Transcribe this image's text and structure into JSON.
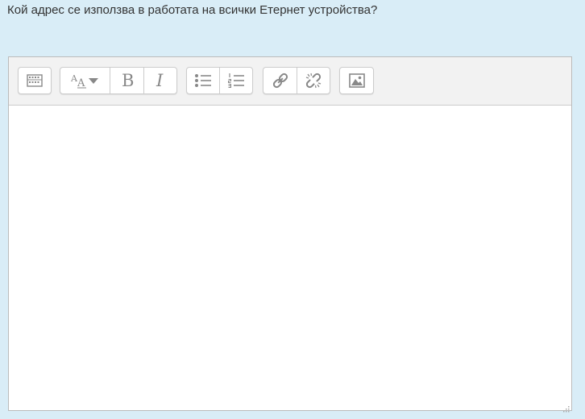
{
  "question": {
    "text": "Кой адрес се използва в работата на всички Етернет устройства?"
  },
  "editor": {
    "content": "",
    "toolbar": {
      "groups": [
        {
          "buttons": [
            {
              "icon": "toolbar-toggle-icon"
            }
          ]
        },
        {
          "buttons": [
            {
              "icon": "font-size-icon"
            },
            {
              "icon": "bold-icon"
            },
            {
              "icon": "italic-icon"
            }
          ]
        },
        {
          "buttons": [
            {
              "icon": "unordered-list-icon"
            },
            {
              "icon": "ordered-list-icon"
            }
          ]
        },
        {
          "buttons": [
            {
              "icon": "link-icon"
            },
            {
              "icon": "unlink-icon"
            }
          ]
        },
        {
          "buttons": [
            {
              "icon": "image-icon"
            }
          ]
        }
      ]
    }
  },
  "colors": {
    "page_background": "#d9edf7",
    "toolbar_background": "#f2f2f2",
    "icon": "#888888",
    "border": "#cccccc"
  }
}
